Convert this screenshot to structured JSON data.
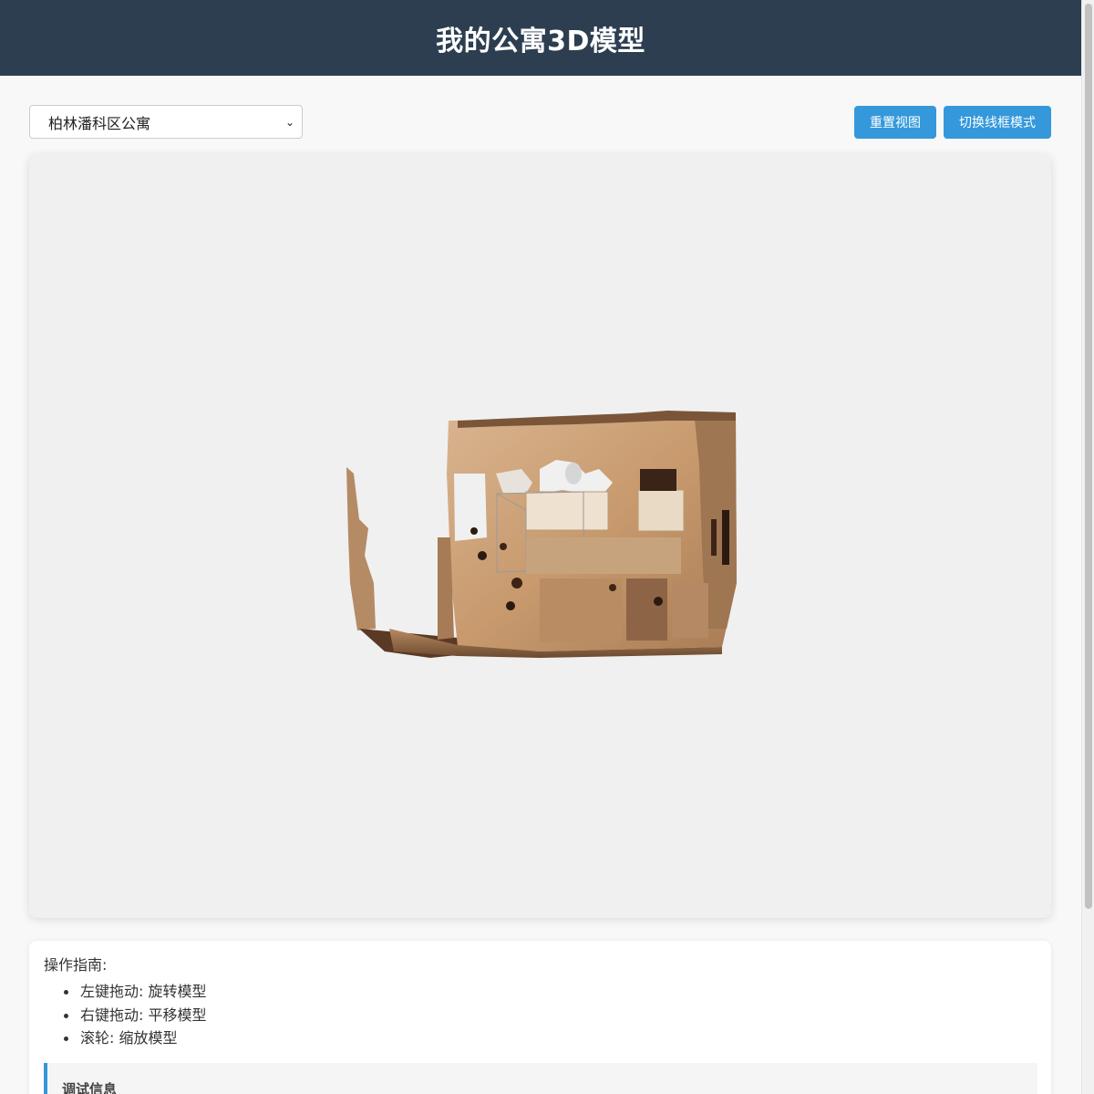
{
  "header": {
    "title": "我的公寓3D模型"
  },
  "model_select": {
    "selected": "柏林潘科区公寓"
  },
  "buttons": {
    "reset_view": "重置视图",
    "toggle_wireframe": "切换线框模式"
  },
  "guide": {
    "title": "操作指南:",
    "items": [
      "左键拖动: 旋转模型",
      "右键拖动: 平移模型",
      "滚轮: 缩放模型"
    ]
  },
  "debug": {
    "title": "调试信息"
  },
  "colors": {
    "header_bg": "#2c3e50",
    "accent": "#3498db",
    "viewer_bg": "#f0f0f0",
    "page_bg": "#f8f8f8"
  }
}
